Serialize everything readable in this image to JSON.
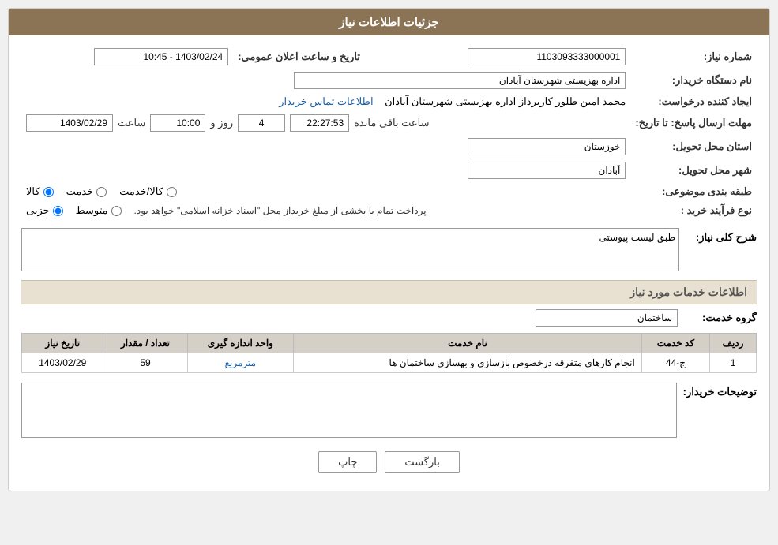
{
  "page": {
    "title": "جزئیات اطلاعات نیاز",
    "header": {
      "background": "#8B7355",
      "text": "جزئیات اطلاعات نیاز"
    }
  },
  "fields": {
    "shomare_niaz_label": "شماره نیاز:",
    "shomare_niaz_value": "1103093333000001",
    "nam_dastgah_label": "نام دستگاه خریدار:",
    "nam_dastgah_value": "اداره بهزیستی شهرستان آبادان",
    "ijad_konande_label": "ایجاد کننده درخواست:",
    "ijad_konande_value": "محمد امین طلور کاربرداز اداره بهزیستی شهرستان آبادان",
    "ijad_konande_link": "اطلاعات تماس خریدار",
    "mohlat_label": "مهلت ارسال پاسخ: تا تاریخ:",
    "mohlat_date": "1403/02/29",
    "mohlat_time_label": "ساعت",
    "mohlat_time": "10:00",
    "mohlat_roz_label": "روز و",
    "mohlat_roz_value": "4",
    "mohlat_saaat_label": "ساعت باقی مانده",
    "mohlat_remaining": "22:27:53",
    "tarikh_label": "تاریخ و ساعت اعلان عمومی:",
    "tarikh_value": "1403/02/24 - 10:45",
    "ostan_label": "استان محل تحویل:",
    "ostan_value": "خوزستان",
    "shahr_label": "شهر محل تحویل:",
    "shahr_value": "آبادان",
    "tabaghebandi_label": "طبقه بندی موضوعی:",
    "tabaghebandi_options": [
      "کالا",
      "خدمت",
      "کالا/خدمت"
    ],
    "tabaghebandi_selected": "کالا",
    "nooe_farayand_label": "نوع فرآیند خرید :",
    "nooe_farayand_options": [
      "جزیی",
      "متوسط"
    ],
    "nooe_farayand_note": "پرداخت تمام یا بخشی از مبلغ خریداز محل \"اسناد خزانه اسلامی\" خواهد بود.",
    "sharh_koli_label": "شرح کلی نیاز:",
    "sharh_koli_value": "طبق لیست پیوستی",
    "services_section_title": "اطلاعات خدمات مورد نیاز",
    "group_label": "گروه خدمت:",
    "group_value": "ساختمان",
    "table_headers": [
      "ردیف",
      "کد خدمت",
      "نام خدمت",
      "واحد اندازه گیری",
      "تعداد / مقدار",
      "تاریخ نیاز"
    ],
    "table_rows": [
      {
        "row": "1",
        "code": "ج-44",
        "name": "انجام کارهای متفرقه درخصوص بازسازی و بهسازی ساختمان ها",
        "unit": "مترمربع",
        "amount": "59",
        "date": "1403/02/29"
      }
    ],
    "tozihat_label": "توضیحات خریدار:",
    "tozihat_value": "",
    "btn_print": "چاپ",
    "btn_back": "بازگشت"
  }
}
